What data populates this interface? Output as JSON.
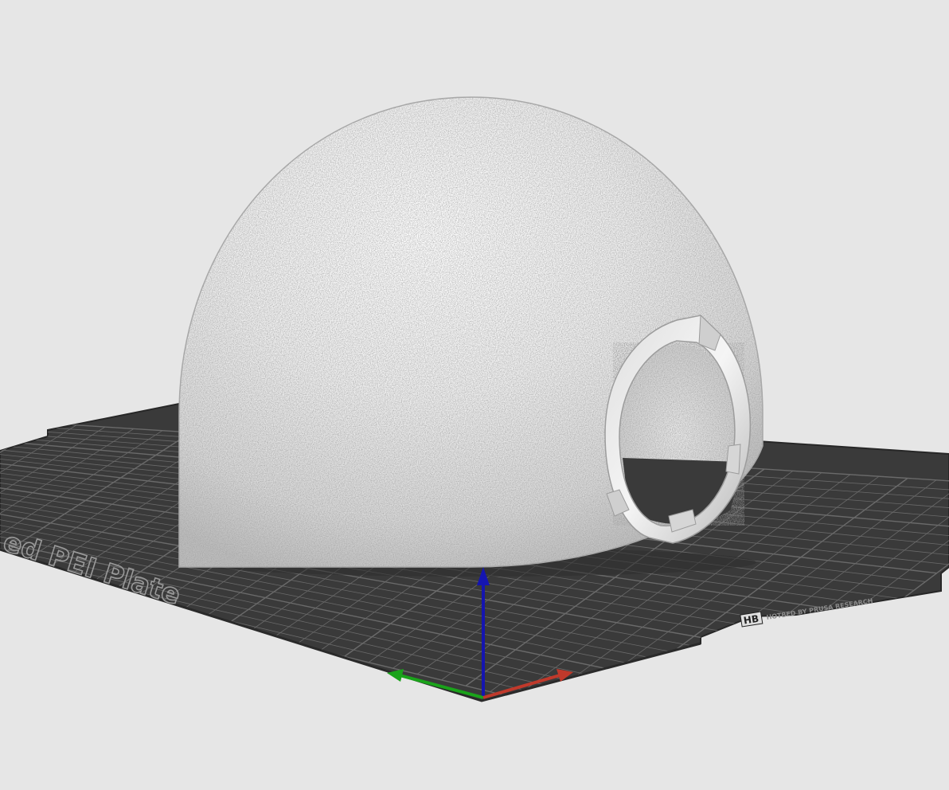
{
  "viewport": {
    "background_color": "#e6e6e6"
  },
  "build_plate": {
    "label_text": "ed PEI Plate",
    "brand_mark": "HB",
    "brand_small_text": "HOTBED BY PRUSA RESEARCH",
    "plate_color": "#3a3a3a",
    "grid_color": "#6a6a6a",
    "edge_color": "#272727"
  },
  "model": {
    "color": "#f2f2f2",
    "shadow_color": "#b5b5b5",
    "port_ring_color": "#c8c8c8"
  },
  "axes": {
    "x_icon": "x-axis-arrow-icon",
    "y_icon": "y-axis-arrow-icon",
    "z_icon": "z-axis-arrow-icon",
    "x_color": "#c0392b",
    "y_color": "#1aa31a",
    "z_color": "#1515b0"
  }
}
